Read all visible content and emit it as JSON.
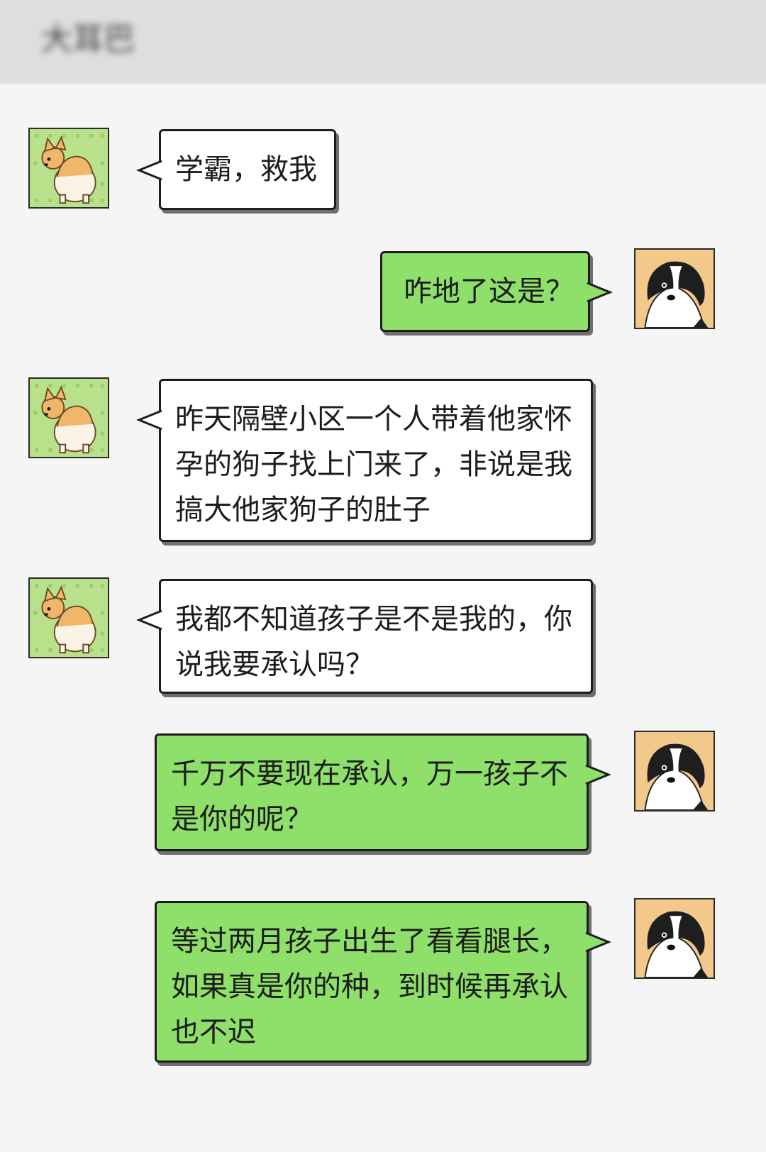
{
  "header": {
    "title": "大耳巴"
  },
  "messages": [
    {
      "side": "left",
      "avatar": "corgi",
      "text": "学霸，救我"
    },
    {
      "side": "right",
      "avatar": "border-collie",
      "text": "咋地了这是？"
    },
    {
      "side": "left",
      "avatar": "corgi",
      "text": "昨天隔壁小区一个人带着他家怀孕的狗子找上门来了，非说是我搞大他家狗子的肚子"
    },
    {
      "side": "left",
      "avatar": "corgi",
      "text": "我都不知道孩子是不是我的，你说我要承认吗？"
    },
    {
      "side": "right",
      "avatar": "border-collie",
      "text": "千万不要现在承认，万一孩子不是你的呢？"
    },
    {
      "side": "right",
      "avatar": "border-collie",
      "text": "等过两月孩子出生了看看腿长，如果真是你的种，到时候再承认也不迟"
    }
  ],
  "colors": {
    "header": "#dedede",
    "background": "#f5f5f5",
    "green_bubble": "#8fe06a",
    "white_bubble": "#ffffff"
  }
}
